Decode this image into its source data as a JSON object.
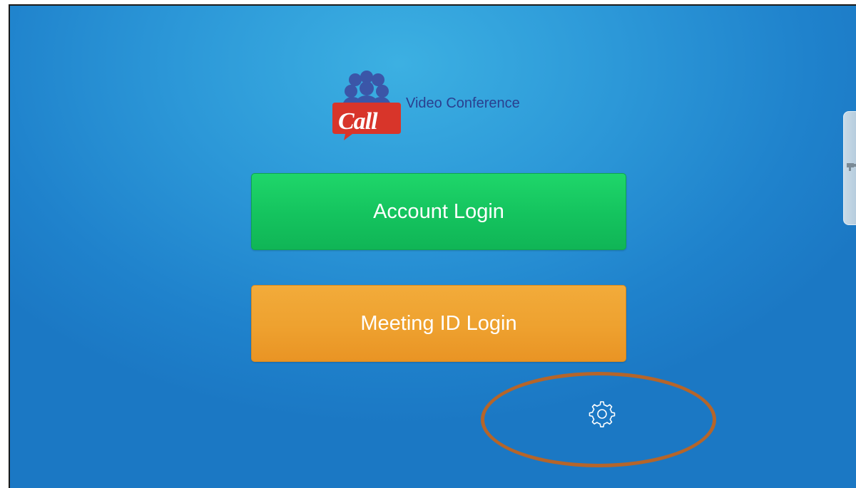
{
  "app": {
    "logo_word": "Call",
    "logo_subtitle": "Video Conference"
  },
  "login": {
    "account_label": "Account Login",
    "meeting_id_label": "Meeting ID Login"
  },
  "settings": {
    "icon": "gear-icon"
  },
  "colors": {
    "background": "#2a93d5",
    "account_button": "#16c75f",
    "meeting_button": "#eea12f",
    "highlight_ring": "#b5652a",
    "subtitle_text": "#2a3f8f",
    "logo_badge": "#d8352a",
    "logo_people": "#3b56a8"
  }
}
